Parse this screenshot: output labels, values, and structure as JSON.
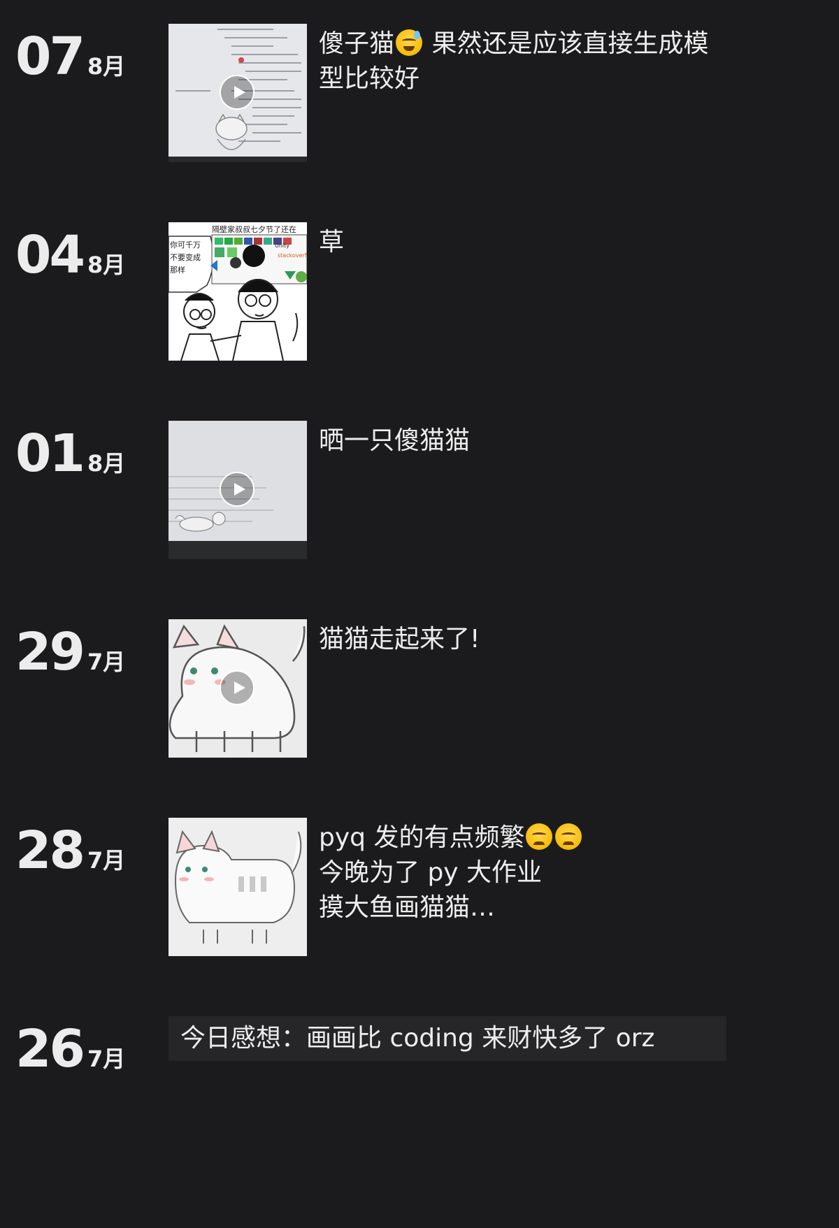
{
  "posts": [
    {
      "day": "07",
      "month": "8月",
      "text_before_emoji": "傻子猫",
      "emoji": "sweat-smile-emoji",
      "text_after_emoji": " 果然还是应该直接生成模型比较好",
      "media": "video",
      "thumbnail": "code-screen-cat"
    },
    {
      "day": "04",
      "month": "8月",
      "text": "草",
      "media": "image",
      "thumbnail": "comic-meme",
      "thumbnail_text": {
        "speech_left": "你可千万\n不要变成\n那样",
        "speech_right": "隔壁家叔叔七夕节了还在",
        "brand_unity": "Unity",
        "brand_stack": "stackoverflow"
      }
    },
    {
      "day": "01",
      "month": "8月",
      "text": "晒一只傻猫猫",
      "media": "video",
      "thumbnail": "monitor-cat"
    },
    {
      "day": "29",
      "month": "7月",
      "text": "猫猫走起来了!",
      "media": "video",
      "thumbnail": "cat-drawing"
    },
    {
      "day": "28",
      "month": "7月",
      "text_line1": "pyq 发的有点频繁",
      "emoji": "pouting-emoji",
      "text_line2": "今晚为了 py 大作业",
      "text_line3": "摸大鱼画猫猫…",
      "media": "image",
      "thumbnail": "cat-drawing-side"
    },
    {
      "day": "26",
      "month": "7月",
      "text": "今日感想：画画比 coding 来财快多了 orz",
      "media": "text-only"
    }
  ],
  "colors": {
    "background": "#1b1b1d",
    "text": "#ededed",
    "text_box": "#262628"
  }
}
